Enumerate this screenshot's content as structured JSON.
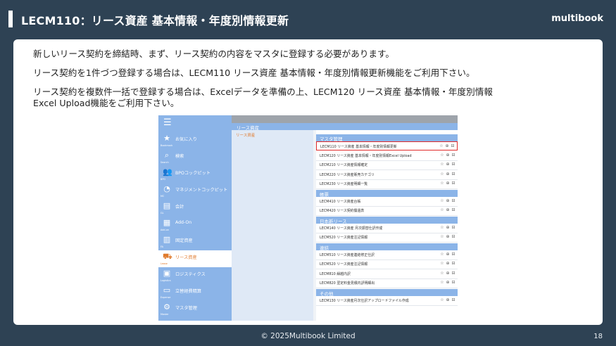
{
  "header": {
    "title": "LECM110：リース資産 基本情報・年度別情報更新",
    "logo": "multibook"
  },
  "body": {
    "paragraph1": "新しいリース契約を締結時、まず、リース契約の内容をマスタに登録する必要があります。",
    "paragraph2": "リース契約を1件づつ登録する場合は、LECM110 リース資産 基本情報・年度別情報更新機能をご利用下さい。",
    "paragraph3_line1": "リース契約を複数件一括で登録する場合は、Excelデータを準備の上、LECM120 リース資産 基本情報・年度別情報",
    "paragraph3_line2": "Excel Upload機能をご利用下さい。"
  },
  "screenshot": {
    "menu_icon": "hamburger-icon",
    "nav": [
      {
        "label": "お気に入り",
        "sub": "Bookmark",
        "icon": "star-icon"
      },
      {
        "label": "検索",
        "sub": "Search",
        "icon": "search-icon"
      },
      {
        "label": "BPOコックピット",
        "sub": "BPO",
        "icon": "people-icon"
      },
      {
        "label": "マネジメントコックピット",
        "sub": "MC",
        "icon": "gauge-icon"
      },
      {
        "label": "会計",
        "sub": "GL",
        "icon": "ledger-icon"
      },
      {
        "label": "Add-On",
        "sub": "Add-on",
        "icon": "grid-icon"
      },
      {
        "label": "固定資産",
        "sub": "FA",
        "icon": "building-icon"
      },
      {
        "label": "リース資産",
        "sub": "Lease",
        "icon": "truck-icon"
      },
      {
        "label": "ロジスティクス",
        "sub": "Logistics",
        "icon": "box-icon"
      },
      {
        "label": "立替経費精算",
        "sub": "Expense",
        "icon": "wallet-icon"
      },
      {
        "label": "マスタ管理",
        "sub": "Master",
        "icon": "gear-icon"
      }
    ],
    "module_title": "リース資産",
    "module_sub_item": "リース資産",
    "sections": [
      {
        "title": "マスタ管理",
        "rows": [
          "LECM110 リース資産 基本情報・年度別情報更新",
          "LECM120 リース資産 基本情報・年度別情報Excel Upload",
          "LECM210 リース資産情報確定",
          "LECM220 リース資産販売カテゴリ",
          "LECM230 リース資産明細一覧"
        ]
      },
      {
        "title": "帳票",
        "rows": [
          "LECM410 リース資産台帳",
          "LECM420 リース契約償還表"
        ]
      },
      {
        "title": "日本新リース",
        "rows": [
          "LECM140 リース資産 月次振替仕訳作成",
          "LECM520 リース資産注記情報"
        ]
      },
      {
        "title": "連結",
        "rows": [
          "LECM510 リース資産連結修正仕訳",
          "LECM520 リース資産注記情報",
          "LECM810 繰越内訳",
          "LECM820 翌定料金見積内訳明細出"
        ]
      },
      {
        "title": "その他",
        "rows": [
          "LECM130 リース資産月次仕訳アップロードファイル作成"
        ]
      }
    ],
    "row_icons": "☆ ⊕ ⊟"
  },
  "footer": {
    "copyright": "© 2025Multibook Limited",
    "page_number": "18"
  },
  "colors": {
    "background": "#2e4254",
    "nav_blue": "#8bb4e8",
    "highlight_red": "#e12a2a",
    "active_orange": "#e07b2e"
  }
}
